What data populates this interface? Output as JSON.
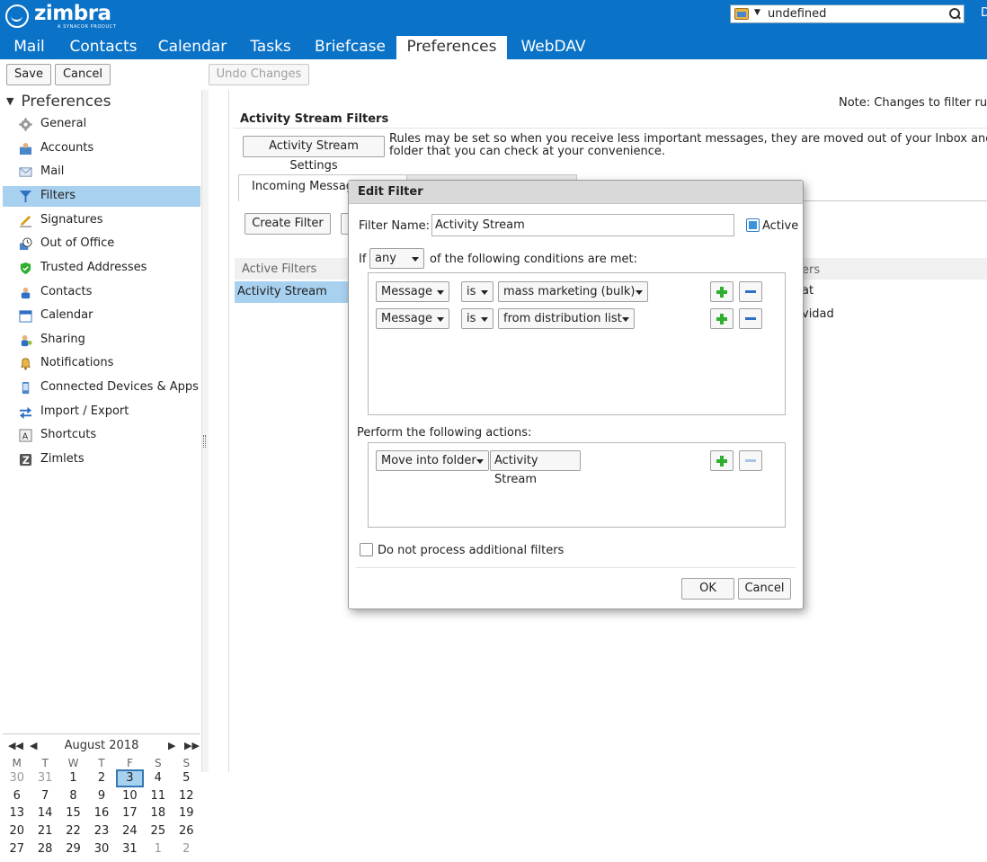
{
  "app": {
    "logo_word": "zimbra",
    "logo_sub": "A SYNACOR PRODUCT",
    "user_initial": "D"
  },
  "search": {
    "value": "undefined"
  },
  "tabs": [
    {
      "label": "Mail",
      "active": false
    },
    {
      "label": "Contacts",
      "active": false
    },
    {
      "label": "Calendar",
      "active": false
    },
    {
      "label": "Tasks",
      "active": false
    },
    {
      "label": "Briefcase",
      "active": false
    },
    {
      "label": "Preferences",
      "active": true
    },
    {
      "label": "WebDAV",
      "active": false
    }
  ],
  "toolbar": {
    "save": "Save",
    "cancel": "Cancel",
    "undo": "Undo Changes"
  },
  "sidebar": {
    "header": "Preferences",
    "items": [
      {
        "label": "General",
        "icon": "gear-icon"
      },
      {
        "label": "Accounts",
        "icon": "accounts-icon"
      },
      {
        "label": "Mail",
        "icon": "mail-icon"
      },
      {
        "label": "Filters",
        "icon": "filter-icon",
        "selected": true
      },
      {
        "label": "Signatures",
        "icon": "signature-icon"
      },
      {
        "label": "Out of Office",
        "icon": "out-of-office-icon"
      },
      {
        "label": "Trusted Addresses",
        "icon": "shield-icon"
      },
      {
        "label": "Contacts",
        "icon": "contacts-icon"
      },
      {
        "label": "Calendar",
        "icon": "calendar-icon"
      },
      {
        "label": "Sharing",
        "icon": "sharing-icon"
      },
      {
        "label": "Notifications",
        "icon": "bell-icon"
      },
      {
        "label": "Connected Devices & Apps",
        "icon": "mobile-device-icon"
      },
      {
        "label": "Import / Export",
        "icon": "import-export-icon"
      },
      {
        "label": "Shortcuts",
        "icon": "keyboard-icon"
      },
      {
        "label": "Zimlets",
        "icon": "zimlet-icon"
      }
    ]
  },
  "calendar": {
    "month": "August 2018",
    "weekdays": [
      "M",
      "T",
      "W",
      "T",
      "F",
      "S",
      "S"
    ],
    "weeks": [
      [
        "30",
        "31",
        "1",
        "2",
        "3",
        "4",
        "5"
      ],
      [
        "6",
        "7",
        "8",
        "9",
        "10",
        "11",
        "12"
      ],
      [
        "13",
        "14",
        "15",
        "16",
        "17",
        "18",
        "19"
      ],
      [
        "20",
        "21",
        "22",
        "23",
        "24",
        "25",
        "26"
      ],
      [
        "27",
        "28",
        "29",
        "30",
        "31",
        "1",
        "2"
      ]
    ],
    "today": "3"
  },
  "content": {
    "note": "Note: Changes to filter rule",
    "section_title": "Activity Stream Filters",
    "settings_button": "Activity Stream Settings",
    "description_line1": "Rules may be set so when you receive less important messages, they are moved out of your Inbox and into",
    "description_line2": "folder that you can check at your convenience.",
    "subtab_incoming": "Incoming Message Filters",
    "create_filter": "Create Filter",
    "active_filters_header": "Active Filters",
    "active_filters": [
      "Activity Stream"
    ],
    "inactive_filters_header": "Available Filters",
    "inactive_filters_visible": [
      "at",
      "vidad"
    ]
  },
  "dialog": {
    "title": "Edit Filter",
    "filter_name_label": "Filter Name:",
    "filter_name_value": "Activity Stream",
    "active_label": "Active",
    "if_label": "If",
    "any_value": "any",
    "conditions_suffix": "of the following conditions are met:",
    "conditions": [
      {
        "field": "Message",
        "op": "is",
        "value": "mass marketing (bulk)"
      },
      {
        "field": "Message",
        "op": "is",
        "value": "from distribution list"
      }
    ],
    "actions_label": "Perform the following actions:",
    "actions": [
      {
        "type": "Move into folder",
        "folder": "Activity Stream"
      }
    ],
    "stop_processing_label": "Do not process additional filters",
    "ok": "OK",
    "cancel": "Cancel"
  },
  "colors": {
    "header_blue": "#0a72c7",
    "selection": "#a8d0ef",
    "add_green": "#2fae2f",
    "remove_blue": "#2f6fc4"
  }
}
